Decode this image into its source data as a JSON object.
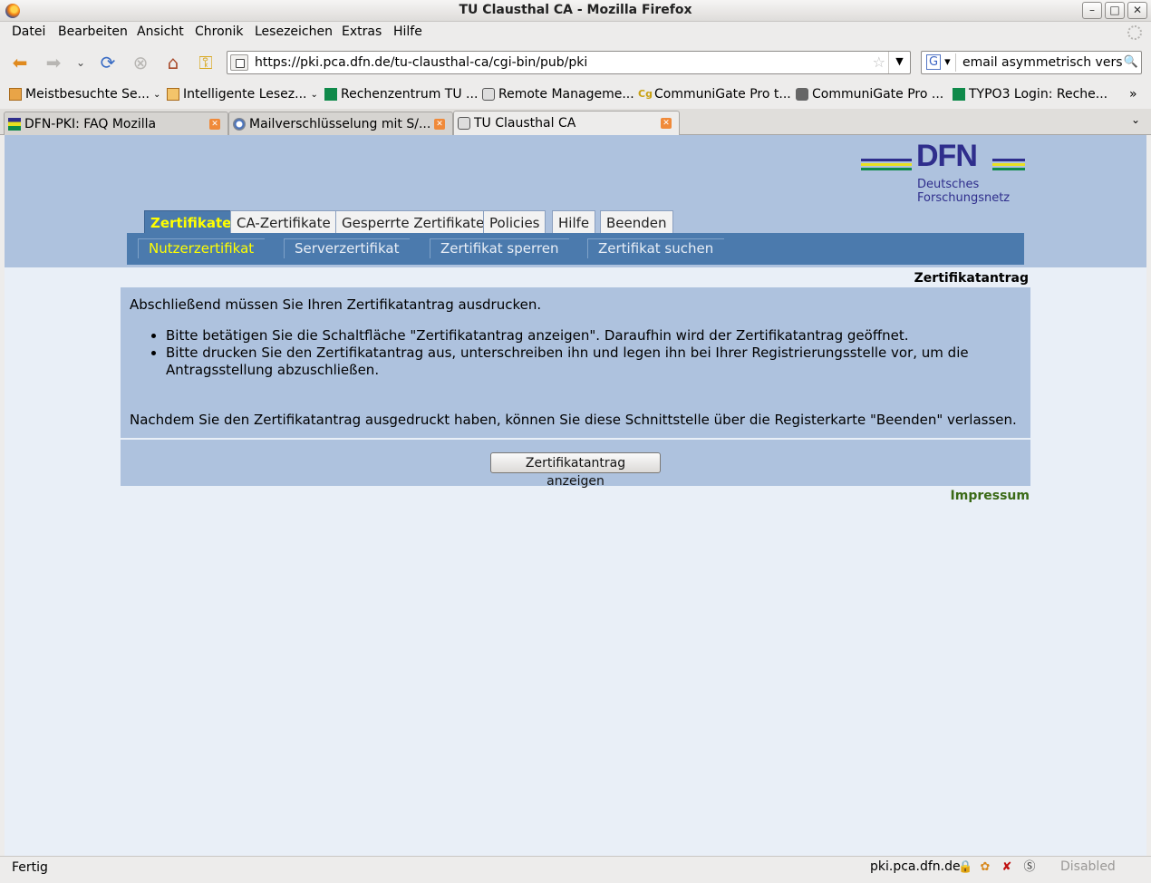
{
  "window": {
    "title": "TU Clausthal CA - Mozilla Firefox",
    "minimize": "–",
    "maximize": "□",
    "close": "✕"
  },
  "menu": [
    {
      "label": "Datei"
    },
    {
      "label": "Bearbeiten"
    },
    {
      "label": "Ansicht"
    },
    {
      "label": "Chronik"
    },
    {
      "label": "Lesezeichen"
    },
    {
      "label": "Extras"
    },
    {
      "label": "Hilfe"
    }
  ],
  "nav": {
    "url": "https://pki.pca.dfn.de/tu-clausthal-ca/cgi-bin/pub/pki",
    "search_engine": "G",
    "search_value": "email asymmetrisch versch"
  },
  "bookmarks": [
    {
      "label": "Meistbesuchte Se..."
    },
    {
      "label": "Intelligente Lesez..."
    },
    {
      "label": "Rechenzentrum TU ..."
    },
    {
      "label": "Remote Manageme..."
    },
    {
      "label": "CommuniGate Pro t..."
    },
    {
      "label": "CommuniGate Pro ..."
    },
    {
      "label": "TYPO3 Login: Reche..."
    }
  ],
  "bookmarks_overflow": "»",
  "tabs": [
    {
      "label": "DFN-PKI: FAQ Mozilla"
    },
    {
      "label": "Mailverschlüsselung mit S/..."
    },
    {
      "label": "TU Clausthal CA"
    }
  ],
  "page": {
    "logo": {
      "name": "DFN",
      "line1": "Deutsches",
      "line2": "Forschungsnetz"
    },
    "main_tabs": [
      {
        "label": "Zertifikate"
      },
      {
        "label": "CA-Zertifikate"
      },
      {
        "label": "Gesperrte Zertifikate"
      },
      {
        "label": "Policies"
      },
      {
        "label": "Hilfe"
      },
      {
        "label": "Beenden"
      }
    ],
    "sub_tabs": [
      {
        "label": "Nutzerzertifikat"
      },
      {
        "label": "Serverzertifikat"
      },
      {
        "label": "Zertifikat sperren"
      },
      {
        "label": "Zertifikat suchen"
      }
    ],
    "section_title": "Zertifikatantrag",
    "intro": "Abschließend müssen Sie Ihren Zertifikatantrag ausdrucken.",
    "bullets": [
      "Bitte betätigen Sie die Schaltfläche \"Zertifikatantrag anzeigen\". Daraufhin wird der Zertifikatantrag geöffnet.",
      "Bitte drucken Sie den Zertifikatantrag aus, unterschreiben ihn und legen ihn bei Ihrer Registrierungsstelle vor, um die Antragsstellung abzuschließen."
    ],
    "outro": "Nachdem Sie den Zertifikatantrag ausgedruckt haben, können Sie diese Schnittstelle über die Registerkarte \"Beenden\" verlassen.",
    "button": "Zertifikatantrag anzeigen",
    "impressum": "Impressum"
  },
  "status": {
    "text": "Fertig",
    "host": "pki.pca.dfn.de",
    "disabled": "Disabled"
  },
  "colors": {
    "banner": "#aec2de",
    "nav_blue": "#4b7aad",
    "active_text": "#ffff00",
    "dfn_blue": "#2f2e8c",
    "impressum": "#3a6a16"
  }
}
